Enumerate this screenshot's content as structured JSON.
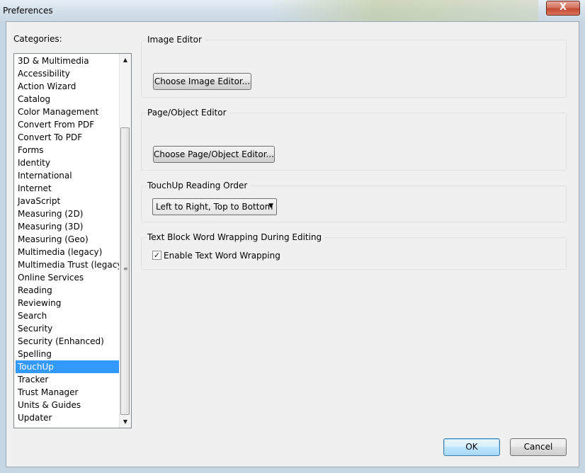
{
  "window": {
    "title": "Preferences",
    "close_label": "X"
  },
  "categories": {
    "label": "Categories:",
    "items": [
      "3D & Multimedia",
      "Accessibility",
      "Action Wizard",
      "Catalog",
      "Color Management",
      "Convert From PDF",
      "Convert To PDF",
      "Forms",
      "Identity",
      "International",
      "Internet",
      "JavaScript",
      "Measuring (2D)",
      "Measuring (3D)",
      "Measuring (Geo)",
      "Multimedia (legacy)",
      "Multimedia Trust (legacy)",
      "Online Services",
      "Reading",
      "Reviewing",
      "Search",
      "Security",
      "Security (Enhanced)",
      "Spelling",
      "TouchUp",
      "Tracker",
      "Trust Manager",
      "Units & Guides",
      "Updater"
    ],
    "selected": "TouchUp"
  },
  "image_editor": {
    "title": "Image Editor",
    "button": "Choose Image Editor..."
  },
  "page_editor": {
    "title": "Page/Object Editor",
    "button": "Choose Page/Object Editor..."
  },
  "reading_order": {
    "title": "TouchUp Reading Order",
    "selected": "Left to Right, Top to Bottom"
  },
  "word_wrap": {
    "title": "Text Block Word Wrapping During Editing",
    "checkbox_label": "Enable Text Word Wrapping",
    "checked": true
  },
  "footer": {
    "ok": "OK",
    "cancel": "Cancel"
  }
}
